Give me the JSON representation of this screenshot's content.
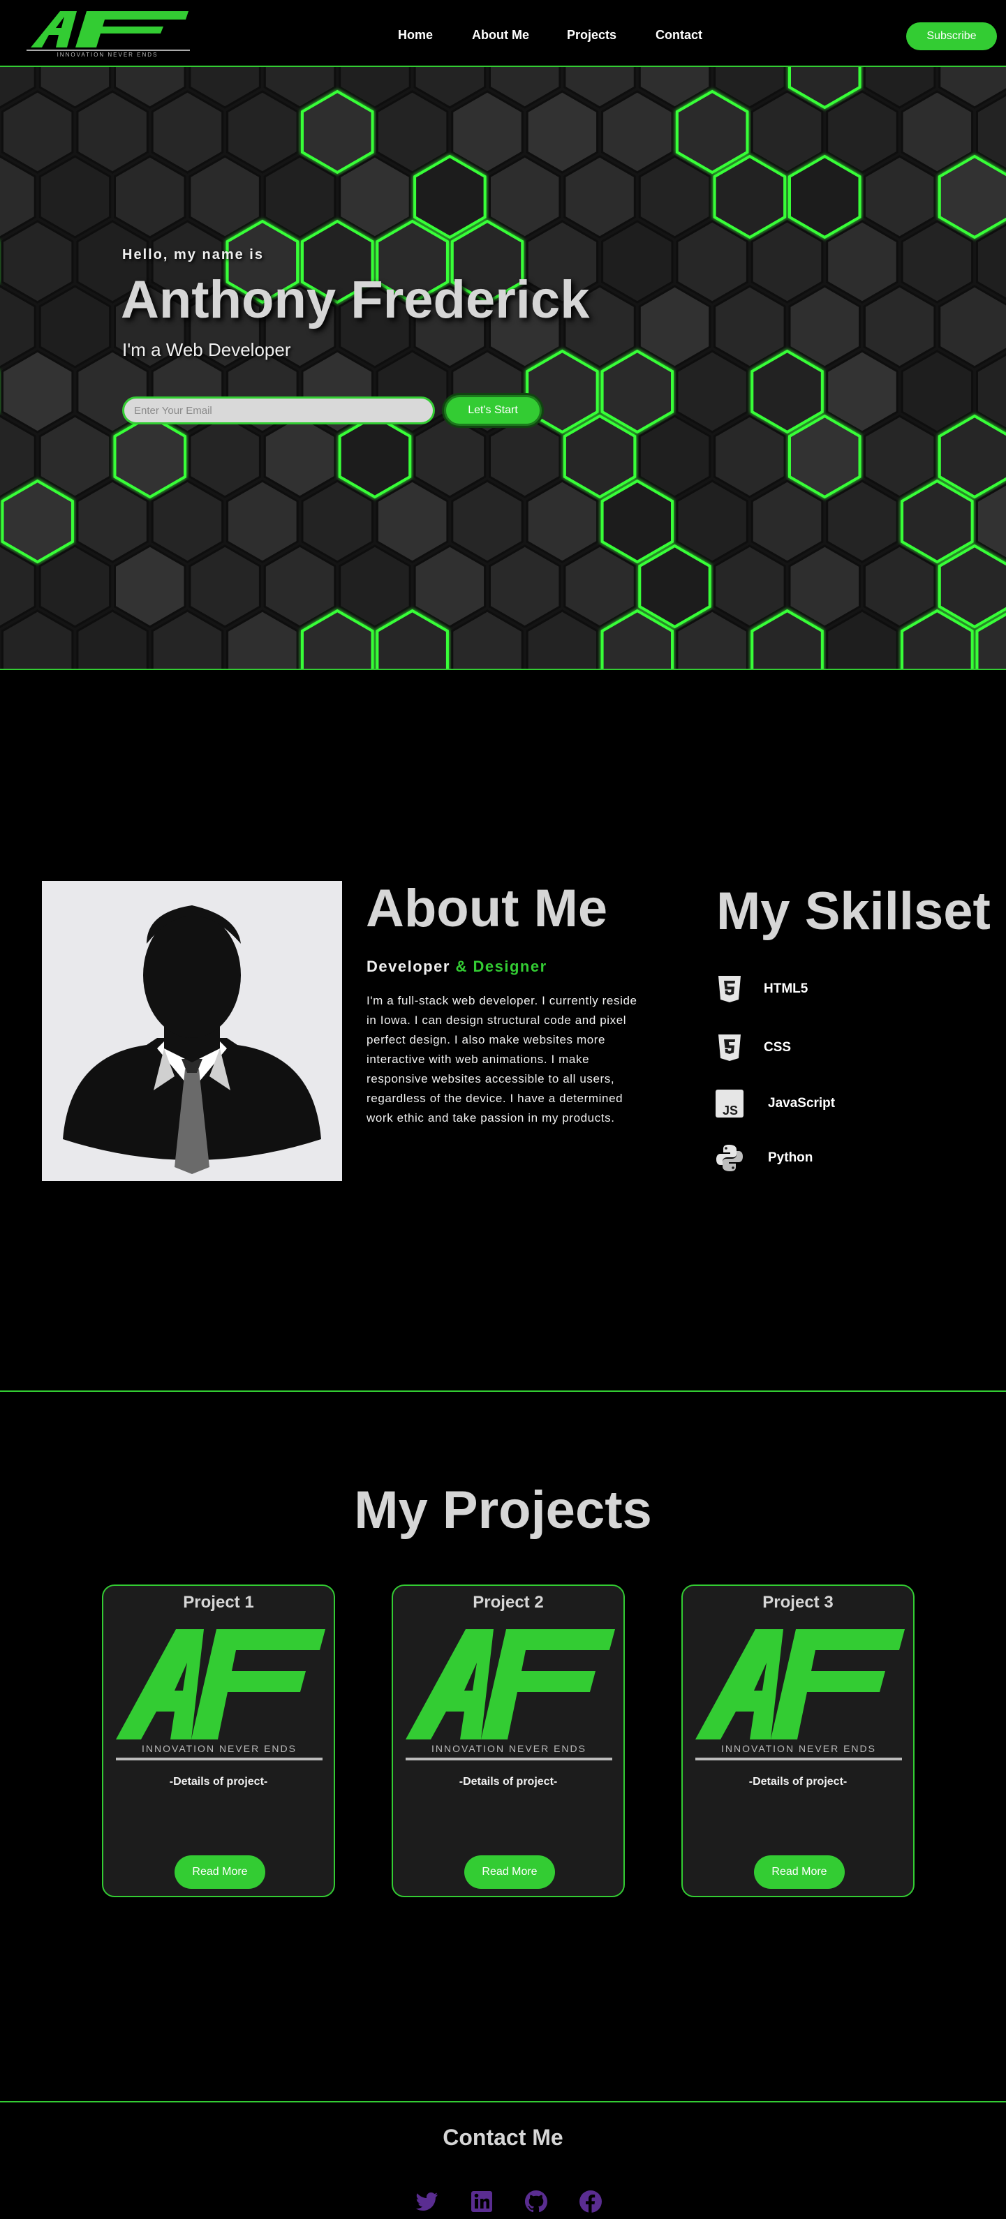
{
  "nav": {
    "logo_text": "AF",
    "logo_tagline": "INNOVATION NEVER ENDS",
    "links": [
      "Home",
      "About Me",
      "Projects",
      "Contact"
    ],
    "subscribe_label": "Subscribe"
  },
  "hero": {
    "greeting": "Hello, my name is",
    "name": "Anthony Frederick",
    "role": "I'm a Web Developer",
    "email_placeholder": "Enter Your Email",
    "cta_label": "Let's Start"
  },
  "about": {
    "title": "About Me",
    "subtitle_main": "Developer",
    "subtitle_accent": "& Designer",
    "body": "I'm a full-stack web developer. I currently reside in Iowa. I can design structural code and pixel perfect design. I also make websites more interactive with web animations. I make responsive websites accessible to all users, regardless of the device. I have a determined work ethic and take passion in my products."
  },
  "skills": {
    "title": "My Skillset",
    "items": [
      {
        "label": "HTML5",
        "icon": "html5-icon"
      },
      {
        "label": "CSS",
        "icon": "css3-icon"
      },
      {
        "label": "JavaScript",
        "icon": "javascript-icon"
      },
      {
        "label": "Python",
        "icon": "python-icon"
      }
    ]
  },
  "projects": {
    "title": "My Projects",
    "cards": [
      {
        "title": "Project 1",
        "logo_text": "AF",
        "tagline": "INNOVATION NEVER ENDS",
        "details": "-Details of project-",
        "button": "Read More"
      },
      {
        "title": "Project 2",
        "logo_text": "AF",
        "tagline": "INNOVATION NEVER ENDS",
        "details": "-Details of project-",
        "button": "Read More"
      },
      {
        "title": "Project 3",
        "logo_text": "AF",
        "tagline": "INNOVATION NEVER ENDS",
        "details": "-Details of project-",
        "button": "Read More"
      }
    ]
  },
  "contact": {
    "title": "Contact Me",
    "socials": [
      "twitter-icon",
      "linkedin-icon",
      "github-icon",
      "facebook-icon"
    ]
  },
  "colors": {
    "accent": "#33cc33",
    "background": "#000000",
    "card": "#1c1c1c",
    "social": "#5a2d91"
  }
}
